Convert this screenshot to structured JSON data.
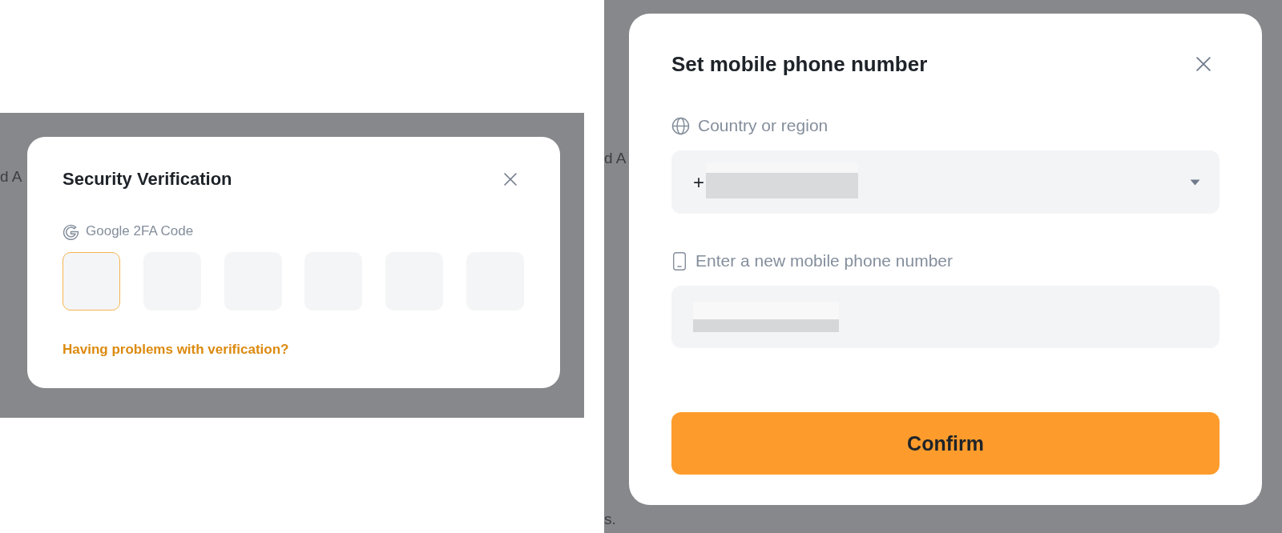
{
  "backdrop_left": {
    "text_fragments": [
      "d A"
    ]
  },
  "security_dialog": {
    "title": "Security Verification",
    "field_label": "Google 2FA Code",
    "code_boxes": [
      {
        "selected": true
      },
      {
        "selected": false
      },
      {
        "selected": false
      },
      {
        "selected": false
      },
      {
        "selected": false
      },
      {
        "selected": false
      }
    ],
    "help_link": "Having problems with verification?"
  },
  "backdrop_right": {
    "text_fragments": [
      "d A",
      "s."
    ]
  },
  "phone_dialog": {
    "title": "Set mobile phone number",
    "country_label": "Country or region",
    "country_select": {
      "value": "+",
      "blurred": true
    },
    "phone_label": "Enter a new mobile phone number",
    "phone_input": {
      "blurred": true
    },
    "button": "Confirm"
  }
}
